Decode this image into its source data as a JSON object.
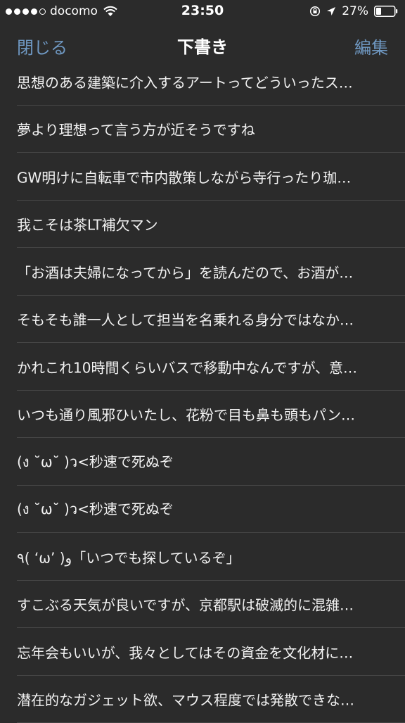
{
  "status_bar": {
    "carrier": "docomo",
    "time": "23:50",
    "battery_percent": "27%",
    "icons": [
      "signal-dots",
      "wifi-icon",
      "orientation-lock-icon",
      "location-arrow-icon",
      "battery-icon"
    ]
  },
  "nav": {
    "left_label": "閉じる",
    "title": "下書き",
    "right_label": "編集",
    "accent_color": "#6f98c2"
  },
  "drafts": [
    "思想のある建築に介入するアートってどういったス…",
    "夢より理想って言う方が近そうですね",
    "GW明けに自転車で市内散策しながら寺行ったり珈…",
    "我こそは茶LT補欠マン",
    "「お酒は夫婦になってから」を読んだので、お酒が…",
    "そもそも誰一人として担当を名乗れる身分ではなか…",
    "かれこれ10時間くらいバスで移動中なんですが、意…",
    "いつも通り風邪ひいたし、花粉で目も鼻も頭もパン…",
    "(ง ˘ω˘ )ว<秒速で死ぬぞ",
    "(ง ˘ω˘ )ว<秒速で死ぬぞ",
    "٩( ‘ω’ )و「いつでも探しているぞ」",
    "すこぶる天気が良いですが、京都駅は破滅的に混雑…",
    "忘年会もいいが、我々としてはその資金を文化材に…",
    "潜在的なガジェット欲、マウス程度では発散できな…"
  ]
}
